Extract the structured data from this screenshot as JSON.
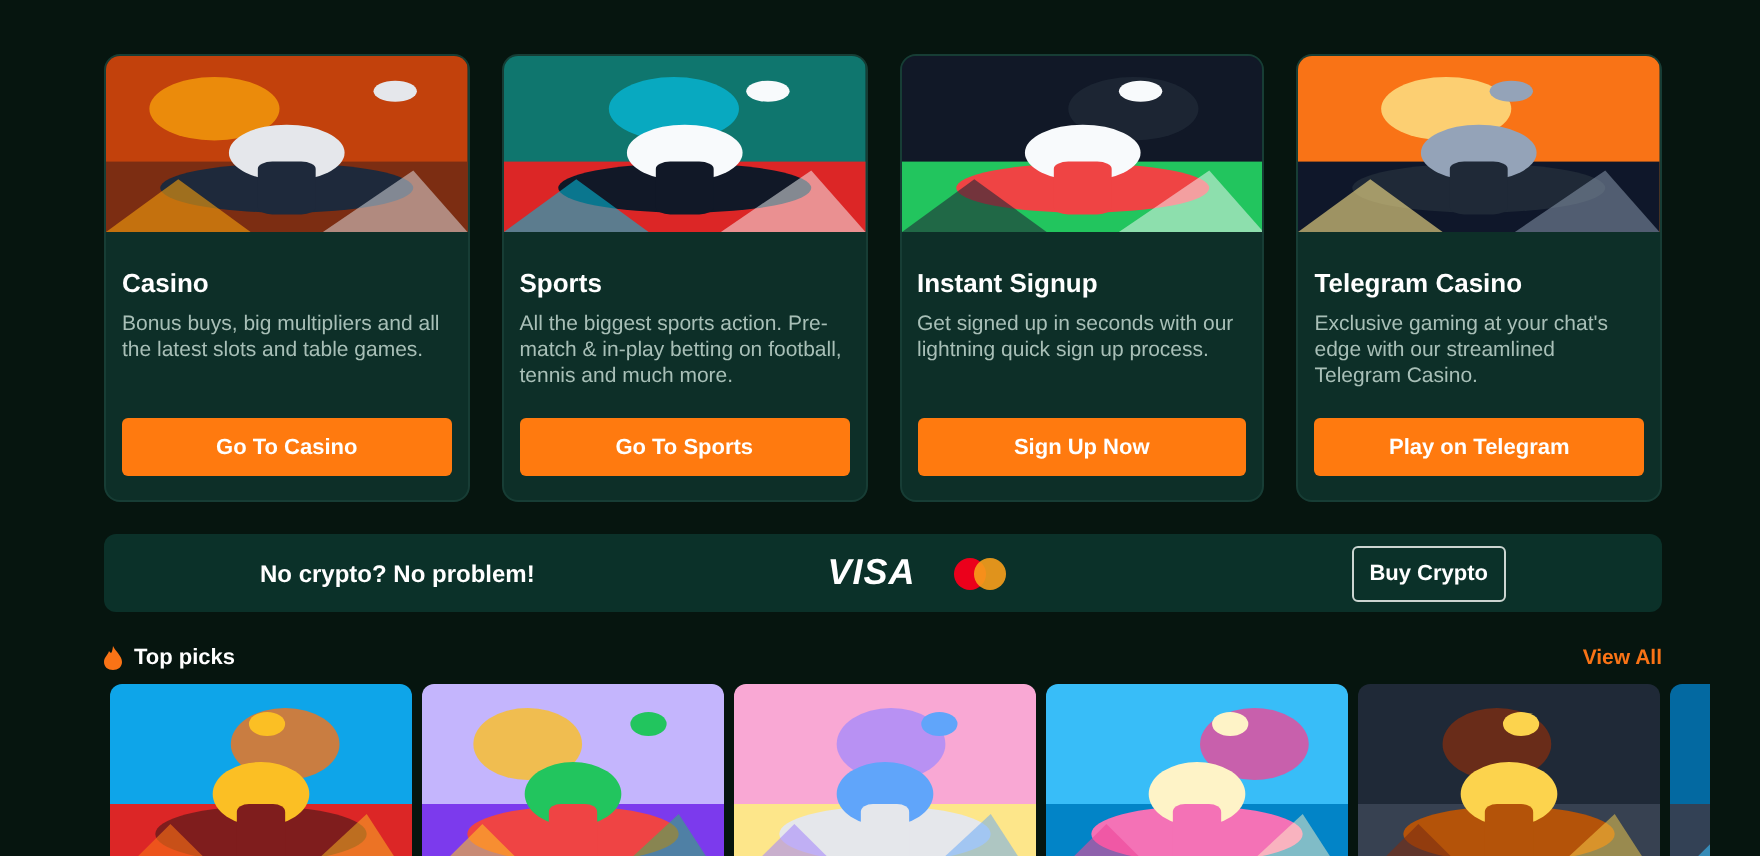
{
  "cards": [
    {
      "title": "Casino",
      "description": "Bonus buys, big multipliers and all the latest slots and table games.",
      "button": "Go To Casino"
    },
    {
      "title": "Sports",
      "description": "All the biggest sports action. Pre-match & in-play betting on football, tennis and much more.",
      "button": "Go To Sports"
    },
    {
      "title": "Instant Signup",
      "description": "Get signed up in seconds with our lightning quick sign up process.",
      "button": "Sign Up Now"
    },
    {
      "title": "Telegram Casino",
      "description": "Exclusive gaming at your chat's edge with our streamlined Telegram Casino.",
      "button": "Play on Telegram"
    }
  ],
  "banner": {
    "text": "No crypto? No problem!",
    "visa": "VISA",
    "button": "Buy Crypto"
  },
  "top_picks": {
    "title": "Top picks",
    "view_all": "View All"
  }
}
